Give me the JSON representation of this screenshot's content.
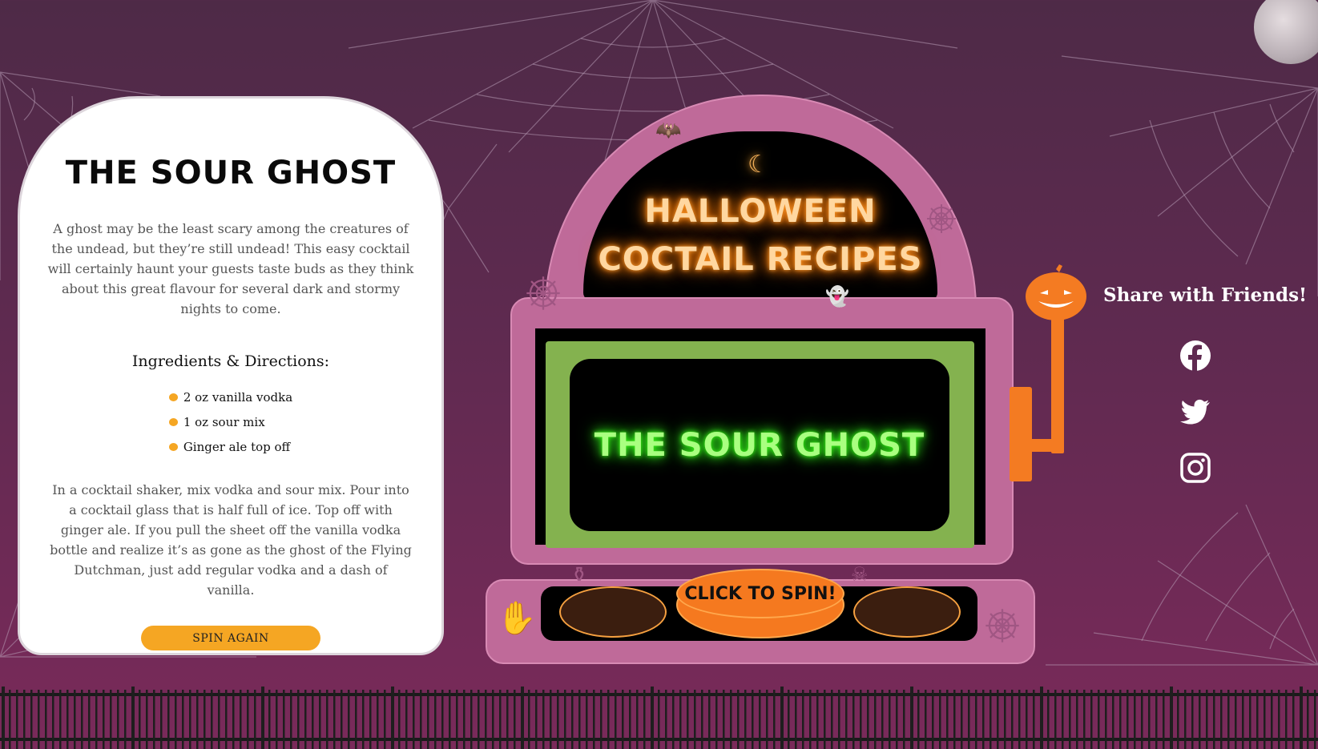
{
  "recipe": {
    "title": "THE SOUR GHOST",
    "description": "A ghost may be the least scary among the creatures of the undead, but they’re still undead! This easy cocktail will certainly haunt your guests taste buds as they think about this great flavour for several dark and stormy nights to come.",
    "ingredients_title": "Ingredients & Directions:",
    "ingredients": [
      "2 oz vanilla vodka",
      "1 oz sour mix",
      "Ginger ale top off"
    ],
    "directions": "In a cocktail shaker, mix vodka and sour mix. Pour into a cocktail glass that is half full of ice. Top off with ginger ale. If you pull the sheet off the vanilla vodka bottle and realize it’s as gone as the ghost of the Flying Dutchman, just add regular vodka and a dash of vanilla.",
    "spin_again_label": "SPIN AGAIN"
  },
  "machine": {
    "title_line1": "HALLOWEEN",
    "title_line2": "COCTAIL RECIPES",
    "reel_result": "THE SOUR GHOST",
    "spin_label": "CLICK TO SPIN!"
  },
  "share": {
    "title": "Share with Friends!",
    "icons": [
      "facebook-icon",
      "twitter-icon",
      "instagram-icon"
    ]
  },
  "colors": {
    "background": "#5f2a50",
    "machine_pink": "#bf6a99",
    "accent_orange": "#f5791f",
    "neon_green": "#39ff14",
    "reel_green": "#84b24f",
    "button_yellow": "#f5a623"
  }
}
